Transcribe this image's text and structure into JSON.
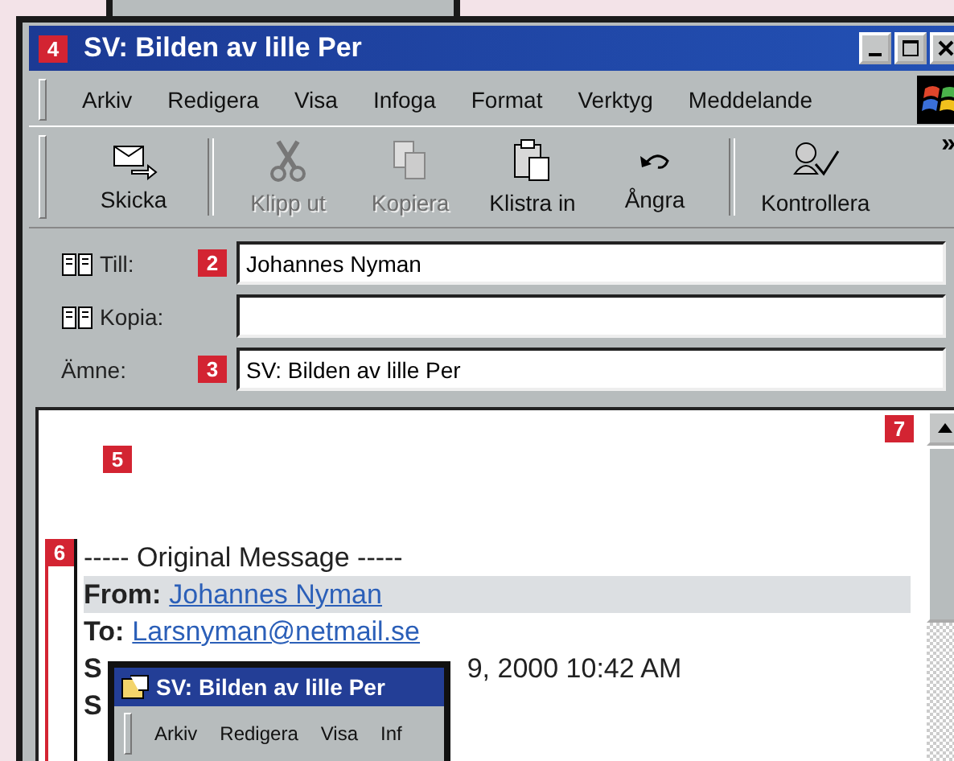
{
  "window": {
    "title": "SV: Bilden av lille Per",
    "callout": "4"
  },
  "menu": [
    "Arkiv",
    "Redigera",
    "Visa",
    "Infoga",
    "Format",
    "Verktyg",
    "Meddelande"
  ],
  "toolbar_groups": [
    [
      {
        "label": "Skicka",
        "kind": "send",
        "disabled": false
      }
    ],
    [
      {
        "label": "Klipp ut",
        "kind": "cut",
        "disabled": true
      },
      {
        "label": "Kopiera",
        "kind": "copy",
        "disabled": true
      },
      {
        "label": "Klistra in",
        "kind": "paste",
        "disabled": false
      },
      {
        "label": "Ångra",
        "kind": "undo",
        "disabled": false
      }
    ],
    [
      {
        "label": "Kontrollera",
        "kind": "check",
        "disabled": false
      }
    ]
  ],
  "toolbar_more": "»",
  "fields": [
    {
      "label": "Till:",
      "address_book": true,
      "value": "Johannes Nyman",
      "callout": "2"
    },
    {
      "label": "Kopia:",
      "address_book": true
    },
    {
      "label": "Ämne:",
      "address_book": false,
      "value": "SV: Bilden av lille Per",
      "callout": "3"
    }
  ],
  "body": {
    "callout": "5",
    "scroll_callout": "7",
    "quote": {
      "callout": "6",
      "header": "----- Original Message -----",
      "lines": [
        {
          "label": "From:",
          "value": "Johannes Nyman",
          "link": true,
          "highlighted": true
        },
        {
          "label": "To:",
          "value": "Larsnyman@netmail.se",
          "link": true,
          "highlighted": false
        },
        {
          "label": "S",
          "value": "9, 2000 10:42 AM",
          "link": false,
          "highlighted": false
        },
        {
          "label": "S",
          "highlighted": false
        }
      ]
    }
  },
  "small_window": {
    "title": "SV: Bilden av lille Per",
    "menu": [
      "Arkiv",
      "Redigera",
      "Visa",
      "Inf"
    ]
  }
}
